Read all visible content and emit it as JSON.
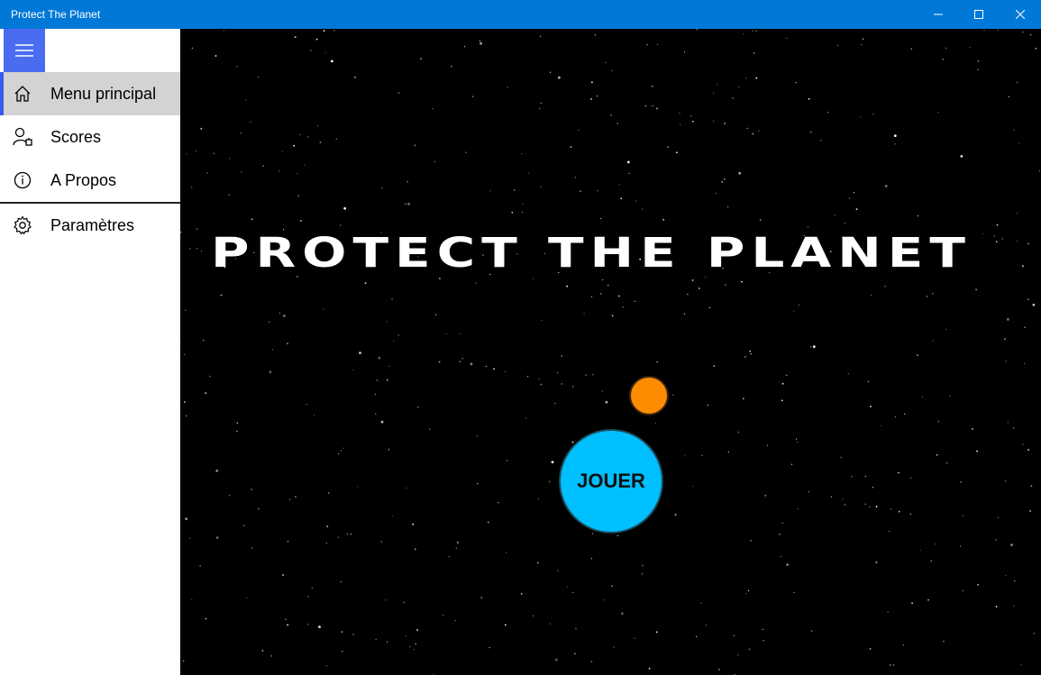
{
  "window": {
    "title": "Protect The Planet",
    "controls": {
      "minimize": "minimize-icon",
      "maximize": "maximize-icon",
      "close": "close-icon"
    }
  },
  "sidebar": {
    "menu_icon": "hamburger-icon",
    "items": [
      {
        "label": "Menu principal",
        "icon": "home-icon",
        "selected": true
      },
      {
        "label": "Scores",
        "icon": "user-badge-icon",
        "selected": false
      },
      {
        "label": "A Propos",
        "icon": "info-icon",
        "selected": false
      }
    ],
    "footer_item": {
      "label": "Paramètres",
      "icon": "gear-icon"
    }
  },
  "main": {
    "game_title": "PROTECT THE PLANET",
    "play_button": "JOUER",
    "colors": {
      "accent": "#0078d7",
      "selection_bar": "#3a5bf0",
      "sun": "#ff8c00",
      "planet": "#00bfff"
    }
  }
}
